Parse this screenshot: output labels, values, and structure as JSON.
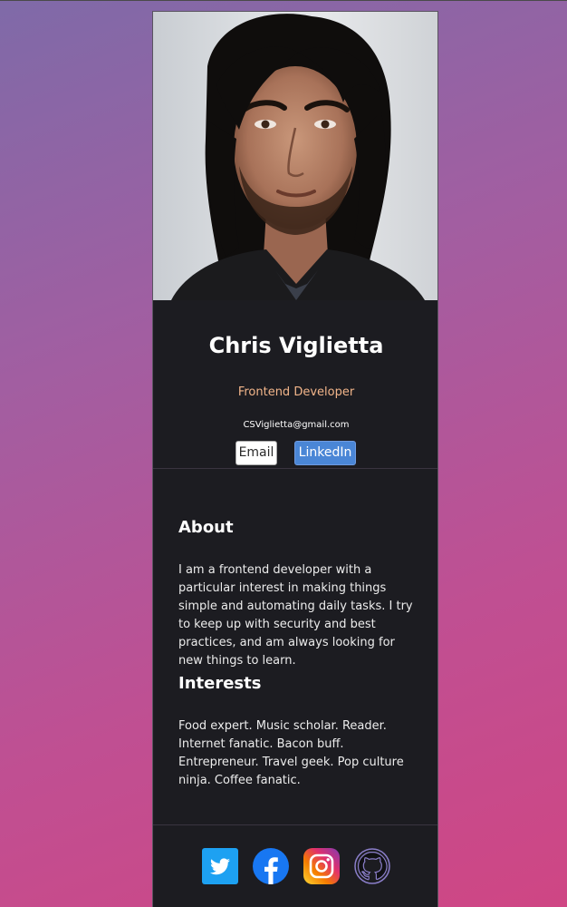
{
  "profile": {
    "photo_alt": "Portrait of Chris Viglietta",
    "name": "Chris Viglietta",
    "role": "Frontend Developer",
    "email": "CSViglietta@gmail.com"
  },
  "buttons": {
    "email_label": "Email",
    "linkedin_label": "LinkedIn"
  },
  "about": {
    "heading": "About",
    "text": "I am a frontend developer with a particular interest in making things simple and automating daily tasks. I try to keep up with security and best practices, and am always looking for new things to learn."
  },
  "interests": {
    "heading": "Interests",
    "text": "Food expert. Music scholar. Reader. Internet fanatic. Bacon buff. Entrepreneur. Travel geek. Pop culture ninja. Coffee fanatic."
  },
  "social": [
    {
      "name": "twitter-icon",
      "color": "#1da1f2"
    },
    {
      "name": "facebook-icon",
      "color": "#1877f2"
    },
    {
      "name": "instagram-icon",
      "color": "#e1306c"
    },
    {
      "name": "github-icon",
      "color": "#161614"
    }
  ],
  "colors": {
    "card_bg": "#1c1c21",
    "accent_role": "#f2b58a",
    "linkedin_button": "#4a86d6"
  }
}
